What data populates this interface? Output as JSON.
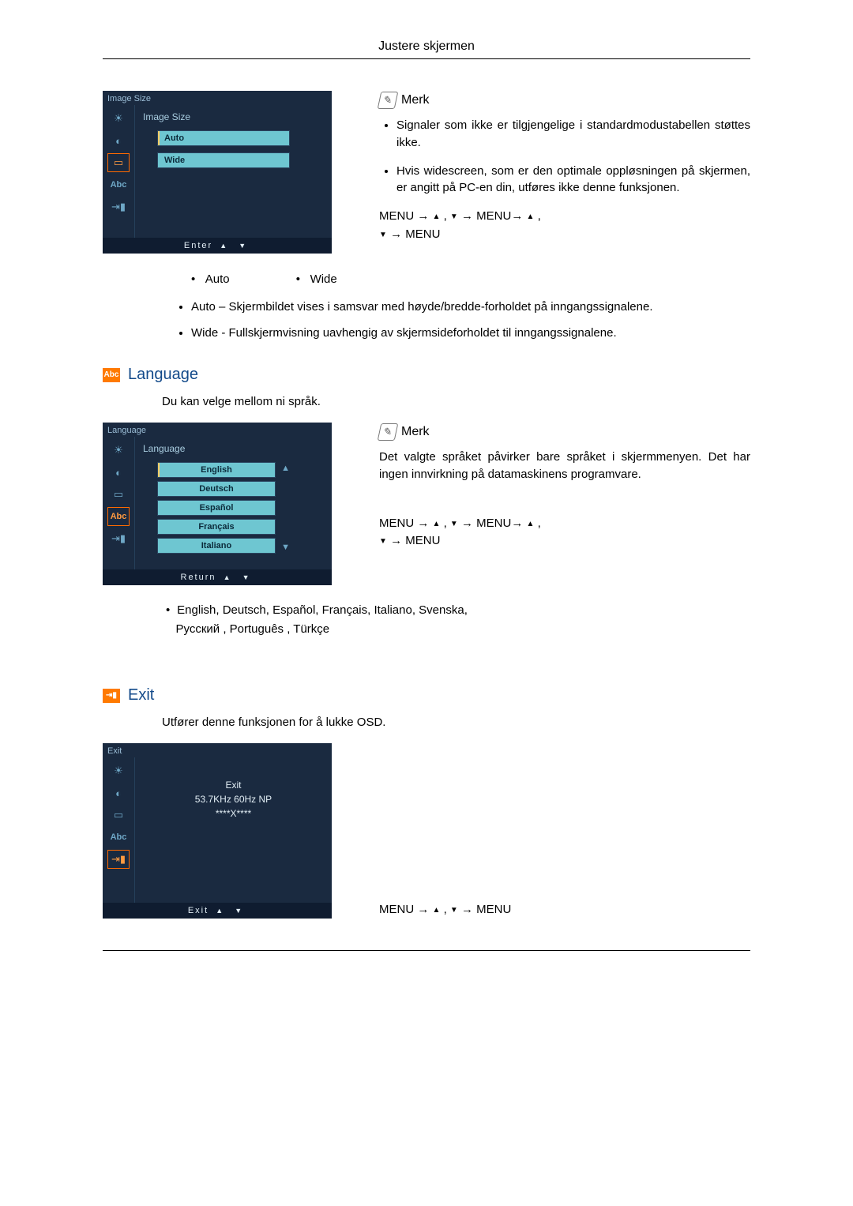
{
  "page_header": "Justere skjermen",
  "image_size": {
    "osd_title": "Image Size",
    "section_title": "Image Size",
    "options": [
      "Auto",
      "Wide"
    ],
    "footer_label": "Enter",
    "note_heading": "Merk",
    "note_items": [
      "Signaler som ikke er tilgjengelige i standardmodustabellen støttes ikke.",
      "Hvis widescreen, som er den optimale oppløsningen på skjermen, er angitt på PC-en din, utføres ikke denne funksjonen."
    ],
    "nav_line1_a": "MENU → ",
    "nav_line1_b": " , ",
    "nav_line1_c": " → MENU→ ",
    "nav_line1_d": " ,",
    "nav_line2_a": " → MENU",
    "inline_opt1": "Auto",
    "inline_opt2": "Wide",
    "desc1_label": "Auto",
    "desc1_text": " – Skjermbildet vises i samsvar med høyde/bredde-forholdet på inngangssignalene.",
    "desc2_label": "Wide",
    "desc2_text": " - Fullskjermvisning uavhengig av skjermsideforholdet til inngangssignalene."
  },
  "language": {
    "heading": "Language",
    "lead": "Du kan velge mellom ni språk.",
    "osd_title": "Language",
    "section_title": "Language",
    "options": [
      "English",
      "Deutsch",
      "Español",
      "Français",
      "Italiano"
    ],
    "footer_label": "Return",
    "note_heading": "Merk",
    "note_text": "Det valgte språket påvirker bare språket i skjermmenyen. Det har ingen innvirkning på datamaskinens programvare.",
    "nav_line1_a": "MENU → ",
    "nav_line1_b": " , ",
    "nav_line1_c": " → MENU→ ",
    "nav_line1_d": " ,",
    "nav_line2_a": " → MENU",
    "extra_line1": "English, Deutsch, Español, Français,  Italiano, Svenska,",
    "extra_line2": "Русский , Português , Türkçe"
  },
  "exit": {
    "heading": "Exit",
    "lead": "Utfører denne funksjonen for å lukke OSD.",
    "osd_title": "Exit",
    "line1": "Exit",
    "line2": "53.7KHz 60Hz NP",
    "line3": "****X****",
    "footer_label": "Exit",
    "nav_a": "MENU → ",
    "nav_b": " , ",
    "nav_c": " → MENU"
  },
  "sidebar_icons": [
    "sun",
    "color",
    "square",
    "abc",
    "exit"
  ]
}
